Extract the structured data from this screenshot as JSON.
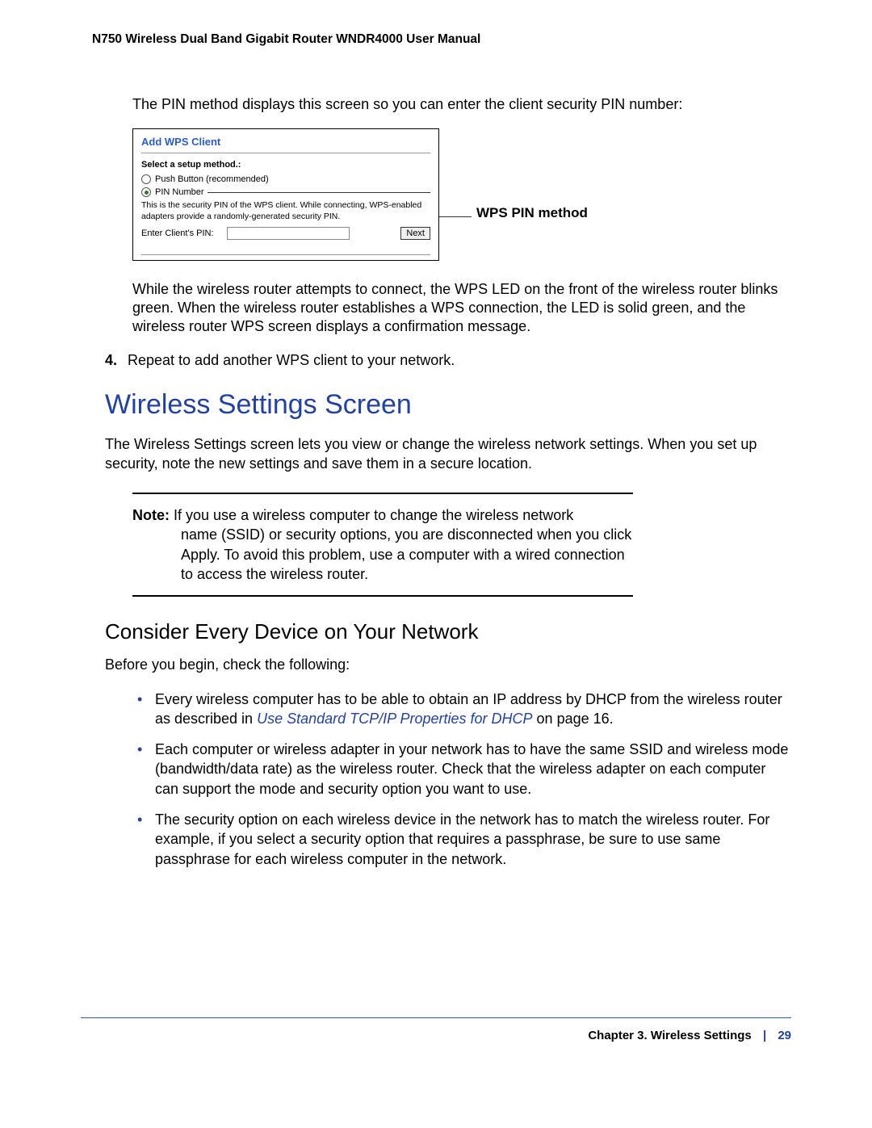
{
  "header": {
    "title": "N750 Wireless Dual Band Gigabit Router WNDR4000 User Manual"
  },
  "intro_para": "The PIN method displays this screen so you can enter the client security PIN number:",
  "wps_panel": {
    "title": "Add WPS Client",
    "select_label": "Select a setup method.:",
    "option_push": "Push Button (recommended)",
    "option_pin": "PIN Number",
    "note": "This is the security PIN of the WPS client. While connecting, WPS-enabled adapters provide a randomly-generated security PIN.",
    "input_label": "Enter Client's PIN:",
    "next_btn": "Next"
  },
  "callout": "WPS PIN method",
  "para_after_figure": "While the wireless router attempts to connect, the WPS LED on the front of the wireless router blinks green. When the wireless router establishes a WPS connection, the LED is solid green, and the wireless router WPS screen displays a confirmation message.",
  "step4": {
    "num": "4.",
    "text": "Repeat to add another WPS client to your network."
  },
  "h2": "Wireless Settings Screen",
  "para_ws": "The Wireless Settings screen lets you view or change the wireless network settings. When you set up security, note the new settings and save them in a secure location.",
  "note": {
    "label": "Note:",
    "text_first_line": "If you use a wireless computer to change the wireless network",
    "text_rest": "name (SSID) or security options, you are disconnected when you click Apply. To avoid this problem, use a computer with a wired connection to access the wireless router."
  },
  "h3": "Consider Every Device on Your Network",
  "para_before": "Before you begin, check the following:",
  "bullets": [
    {
      "pre": "Every wireless computer has to be able to obtain an IP address by DHCP from the wireless router as described in ",
      "link": "Use Standard TCP/IP Properties for DHCP",
      "post": " on page 16."
    },
    {
      "pre": "Each computer or wireless adapter in your network has to have the same SSID and wireless mode (bandwidth/data rate) as the wireless router. Check that the wireless adapter on each computer can support the mode and security option you want to use.",
      "link": "",
      "post": ""
    },
    {
      "pre": "The security option on each wireless device in the network has to match the wireless router. For example, if you select a security option that requires a passphrase, be sure to use same passphrase for each wireless computer in the network.",
      "link": "",
      "post": ""
    }
  ],
  "footer": {
    "chapter": "Chapter 3.  Wireless Settings",
    "page": "29"
  }
}
